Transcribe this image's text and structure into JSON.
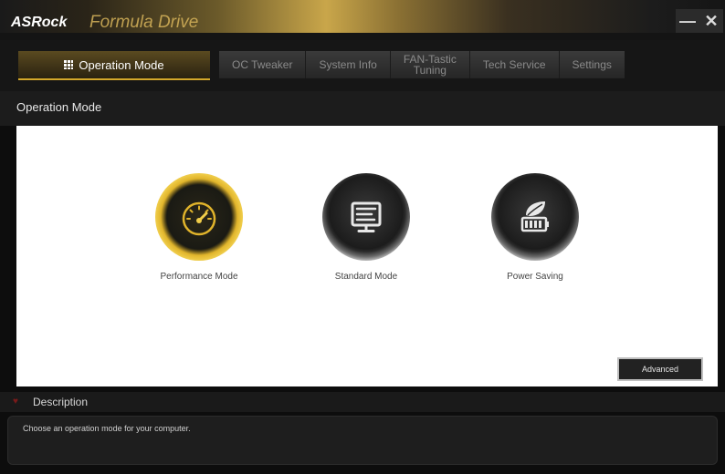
{
  "window": {
    "brand": "ASRock",
    "app_title": "Formula Drive",
    "minimize_label": "—",
    "close_label": "✕"
  },
  "tabs": {
    "active": "Operation Mode",
    "items": [
      "OC Tweaker",
      "System Info",
      "FAN-Tastic\nTuning",
      "Tech Service",
      "Settings"
    ]
  },
  "section": {
    "title": "Operation Mode"
  },
  "modes": [
    {
      "label": "Performance Mode",
      "icon": "speedometer-icon",
      "selected": true
    },
    {
      "label": "Standard Mode",
      "icon": "monitor-icon",
      "selected": false
    },
    {
      "label": "Power Saving",
      "icon": "leaf-battery-icon",
      "selected": false
    }
  ],
  "advanced_label": "Advanced",
  "description": {
    "title": "Description",
    "text": "Choose an operation mode for your computer."
  },
  "colors": {
    "accent_gold": "#d4a82a",
    "background": "#0d0d0d",
    "panel": "#ffffff"
  }
}
